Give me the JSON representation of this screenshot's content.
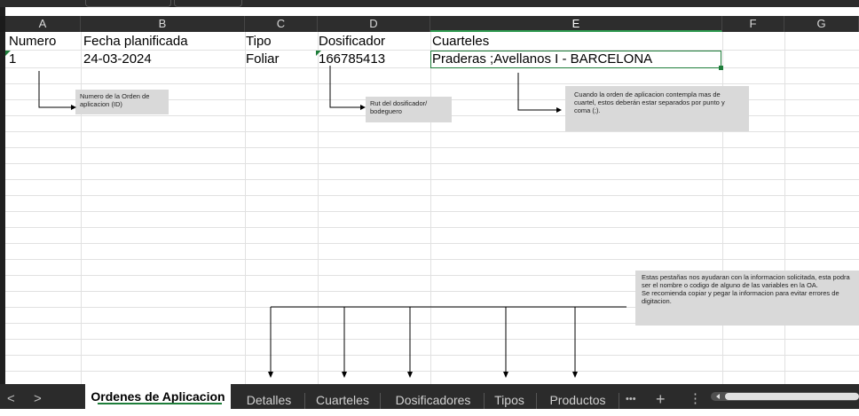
{
  "columns": [
    "A",
    "B",
    "C",
    "D",
    "E",
    "F",
    "G"
  ],
  "header_row": {
    "numero": "Numero",
    "fecha": "Fecha planificada",
    "tipo": "Tipo",
    "dosificador": "Dosificador",
    "cuarteles": "Cuarteles"
  },
  "data_row": {
    "numero": "1",
    "fecha": "24-03-2024",
    "tipo": "Foliar",
    "dosificador": "166785413",
    "cuarteles": "Praderas ;Avellanos I - BARCELONA"
  },
  "notes": {
    "id": "Numero de la Orden de aplicacion (ID)",
    "rut": "Rut del dosificador/ bodeguero",
    "cuartel": "Cuando la orden de aplicacion contempla mas de cuartel, estos deberán estar separados por punto y coma (;).",
    "pestanas": "Estas pestañas nos ayudaran con la informacion solicitada, esta podra ser el nombre o codigo de alguno de las variables en la OA.",
    "pestanas2": "Se recomienda copiar y pegar la informacion para evitar errores de digitacion."
  },
  "tabs": {
    "prev": "<",
    "next": ">",
    "active": "Ordenes de Aplicacion",
    "items": [
      "Detalles",
      "Cuarteles",
      "Dosificadores",
      "Tipos",
      "Productos"
    ],
    "more": "•••",
    "add": "+",
    "options": "⋮"
  },
  "colors": {
    "accent": "#1e7d3a",
    "note_bg": "#d9d9d9",
    "header_bg": "#2d2d2d"
  }
}
